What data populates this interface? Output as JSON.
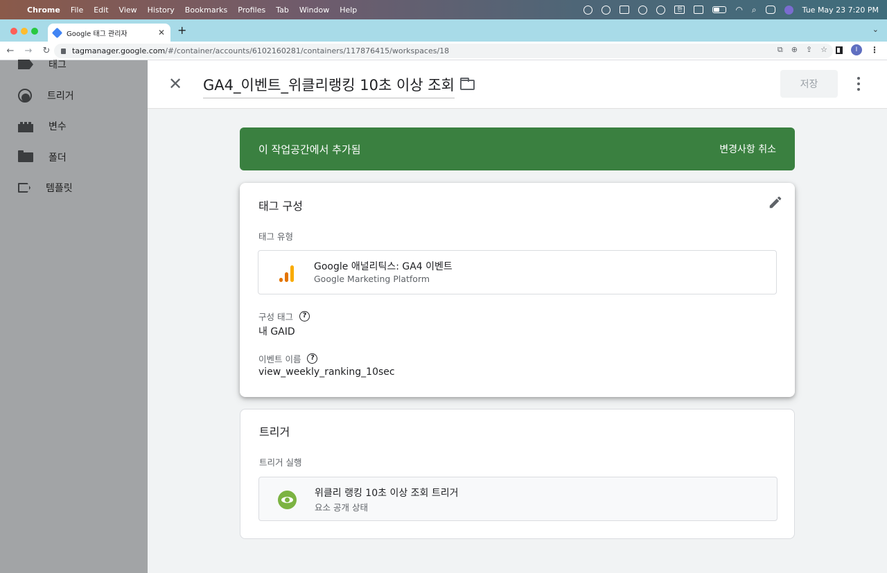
{
  "menubar": {
    "app": "Chrome",
    "items": [
      "File",
      "Edit",
      "View",
      "History",
      "Bookmarks",
      "Profiles",
      "Tab",
      "Window",
      "Help"
    ],
    "ime": "한",
    "clock": "Tue May 23  7:20 PM"
  },
  "browser": {
    "tab_title": "Google 태그 관리자",
    "url_host": "tagmanager.google.com",
    "url_path": "/#/container/accounts/6102160281/containers/117876415/workspaces/18",
    "profile_initial": "I"
  },
  "sidebar": {
    "items": [
      {
        "label": "태그",
        "icon": "tag-icon"
      },
      {
        "label": "트리거",
        "icon": "trigger-icon"
      },
      {
        "label": "변수",
        "icon": "variable-icon"
      },
      {
        "label": "폴더",
        "icon": "folder-icon"
      },
      {
        "label": "템플릿",
        "icon": "template-icon"
      }
    ]
  },
  "editor": {
    "tag_name": "GA4_이벤트_위클리랭킹 10초 이상 조회",
    "save_label": "저장"
  },
  "banner": {
    "text": "이 작업공간에서 추가됨",
    "revert_label": "변경사항 취소",
    "color": "#3a8040"
  },
  "tag_config": {
    "title": "태그 구성",
    "type_label": "태그 유형",
    "type_name": "Google 애널리틱스: GA4 이벤트",
    "type_vendor": "Google Marketing Platform",
    "config_tag_label": "구성 태그",
    "config_tag_value": "내 GAID",
    "event_name_label": "이벤트 이름",
    "event_name_value": "view_weekly_ranking_10sec"
  },
  "triggering": {
    "title": "트리거",
    "firing_label": "트리거 실행",
    "trigger_name": "위클리 랭킹 10초 이상 조회 트리거",
    "trigger_type": "요소 공개 상태"
  }
}
